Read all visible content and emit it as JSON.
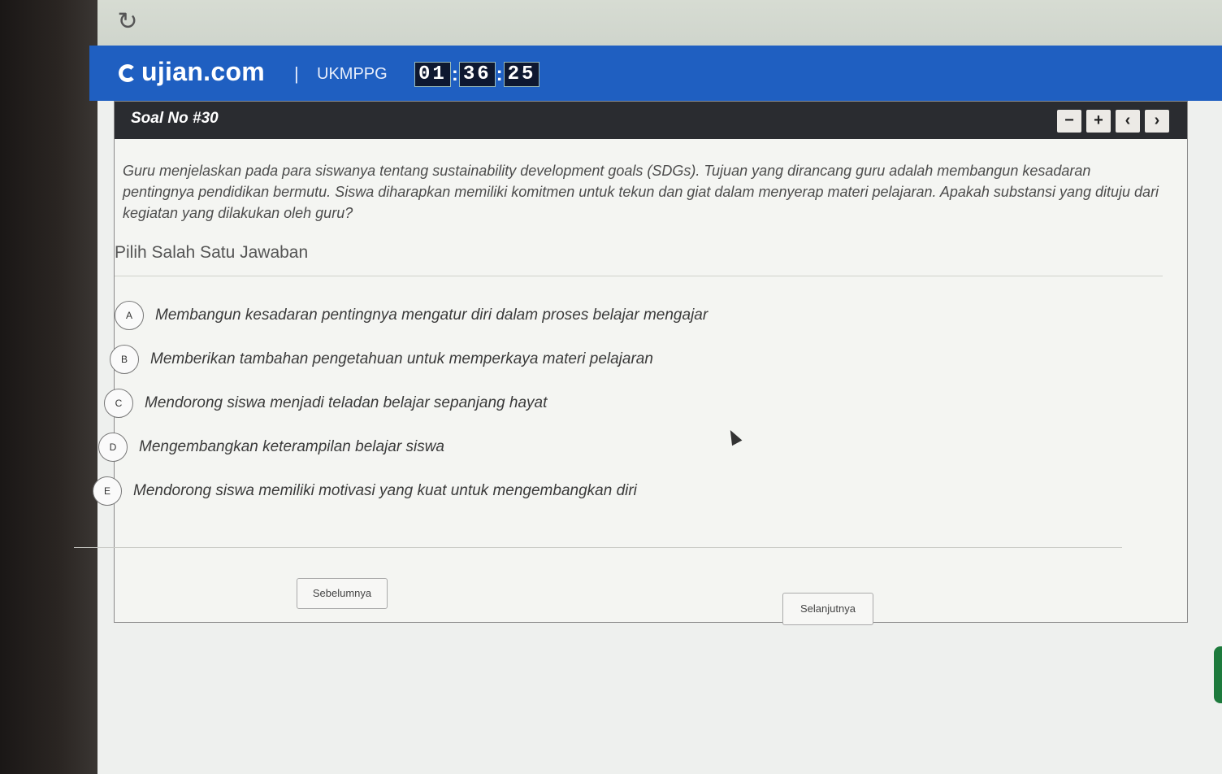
{
  "site": {
    "logo": "ujian.com",
    "separator": "|",
    "exam": "UKMPPG"
  },
  "timer": {
    "hours": "01",
    "minutes": "36",
    "seconds": "25"
  },
  "question": {
    "title": "Soal No #30",
    "text": "Guru menjelaskan pada para siswanya tentang sustainability development goals (SDGs). Tujuan yang dirancang guru adalah membangun kesadaran pentingnya pendidikan bermutu. Siswa diharapkan memiliki komitmen untuk tekun dan giat dalam menyerap materi pelajaran. Apakah substansi yang dituju dari kegiatan yang dilakukan oleh guru?",
    "instruction": "Pilih Salah Satu Jawaban"
  },
  "options": [
    {
      "letter": "A",
      "text": "Membangun kesadaran pentingnya mengatur diri dalam proses belajar mengajar"
    },
    {
      "letter": "B",
      "text": "Memberikan tambahan pengetahuan untuk memperkaya materi pelajaran"
    },
    {
      "letter": "C",
      "text": "Mendorong siswa menjadi teladan belajar sepanjang hayat"
    },
    {
      "letter": "D",
      "text": "Mengembangkan keterampilan belajar siswa"
    },
    {
      "letter": "E",
      "text": "Mendorong siswa memiliki motivasi yang kuat untuk mengembangkan diri"
    }
  ],
  "tools": {
    "minus": "−",
    "plus": "+",
    "prev": "‹",
    "next": "›"
  },
  "nav": {
    "prev_label": "Sebelumnya",
    "next_label": "Selanjutnya"
  },
  "colors": {
    "header": "#1f5fc1",
    "panel_head": "#2a2c30"
  },
  "icons": {
    "reload": "reload-icon",
    "logo": "logo-icon",
    "cursor": "mouse-cursor-icon"
  }
}
